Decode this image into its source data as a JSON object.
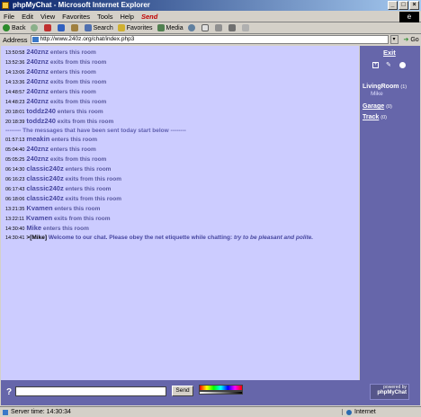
{
  "window": {
    "title": "phpMyChat - Microsoft Internet Explorer"
  },
  "menu": [
    "File",
    "Edit",
    "View",
    "Favorites",
    "Tools",
    "Help"
  ],
  "menu_send": "Send",
  "toolbar": {
    "back": "Back",
    "search": "Search",
    "favorites": "Favorites",
    "media": "Media"
  },
  "address": {
    "label": "Address",
    "url": "http://www.240z.org/chat/index.php3",
    "go": "Go"
  },
  "messages": [
    {
      "time": "13:50:58",
      "nick": "240znz",
      "text": "enters this room"
    },
    {
      "time": "13:52:36",
      "nick": "240znz",
      "text": "exits from this room"
    },
    {
      "time": "14:13:06",
      "nick": "240znz",
      "text": "enters this room"
    },
    {
      "time": "14:13:36",
      "nick": "240znz",
      "text": "exits from this room"
    },
    {
      "time": "14:48:57",
      "nick": "240znz",
      "text": "enters this room"
    },
    {
      "time": "14:48:23",
      "nick": "240znz",
      "text": "exits from this room"
    },
    {
      "time": "20:18:01",
      "nick": "toddz240",
      "text": "enters this room"
    },
    {
      "time": "20:18:39",
      "nick": "toddz240",
      "text": "exits from this room"
    }
  ],
  "divider": "-------- The messages that have been sent today start below --------",
  "today": [
    {
      "time": "01:57:13",
      "nick": "meakin",
      "text": "enters this room"
    },
    {
      "time": "05:04:40",
      "nick": "240znz",
      "text": "enters this room"
    },
    {
      "time": "05:05:25",
      "nick": "240znz",
      "text": "exits from this room"
    },
    {
      "time": "06:14:30",
      "nick": "classic240z",
      "text": "enters this room"
    },
    {
      "time": "06:16:23",
      "nick": "classic240z",
      "text": "exits from this room"
    },
    {
      "time": "06:17:43",
      "nick": "classic240z",
      "text": "enters this room"
    },
    {
      "time": "06:18:06",
      "nick": "classic240z",
      "text": "exits from this room"
    },
    {
      "time": "13:21:35",
      "nick": "Kvamen",
      "text": "enters this room"
    },
    {
      "time": "13:22:11",
      "nick": "Kvamen",
      "text": "exits from this room"
    },
    {
      "time": "14:30:40",
      "nick": "Mike",
      "text": "enters this room"
    }
  ],
  "welcome": {
    "time": "14:30:41",
    "who": ">[Mike]",
    "text": "Welcome to our chat. Please obey the net etiquette while chatting:",
    "italic": "try to be pleasant and polite."
  },
  "sidebar": {
    "exit": "Exit",
    "rooms": [
      {
        "name": "LivingRoom",
        "count": "(1)",
        "users": [
          "Mike"
        ]
      },
      {
        "name": "Garage",
        "count": "(0)",
        "users": []
      },
      {
        "name": "Track",
        "count": "(0)",
        "users": []
      }
    ]
  },
  "input": {
    "help": "?",
    "send": "Send",
    "powered1": "powered by",
    "powered2": "phpMyChat"
  },
  "status": {
    "left": "Server time: 14:30:34",
    "right": "Internet"
  },
  "colors": {
    "chat_bg": "#ccccff",
    "sidebar_bg": "#6666aa"
  }
}
